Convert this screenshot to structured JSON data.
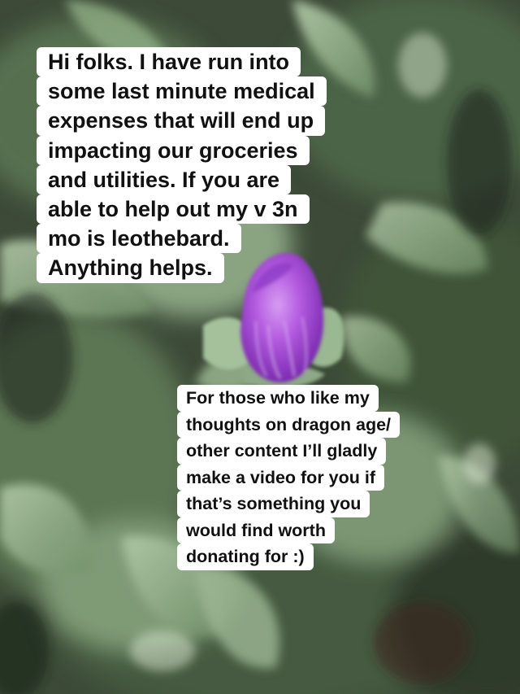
{
  "caption_top": {
    "lines": [
      "Hi folks. I have run into",
      "some last minute medical",
      "expenses that will end up",
      "impacting our groceries",
      "and utilities. If you are",
      "able to help out my v 3n",
      "mo is leothebard.",
      "Anything helps."
    ]
  },
  "caption_bottom": {
    "lines": [
      "For those who like my",
      "thoughts on dragon age/",
      "other content I’ll gladly",
      "make a video for you if",
      "that’s something you",
      "would find worth",
      "donating for :)"
    ]
  },
  "colors": {
    "caption_background": "#ffffff",
    "caption_text": "#111111",
    "flower_bud": "#b45be0",
    "leaves": "#7f9a78"
  }
}
